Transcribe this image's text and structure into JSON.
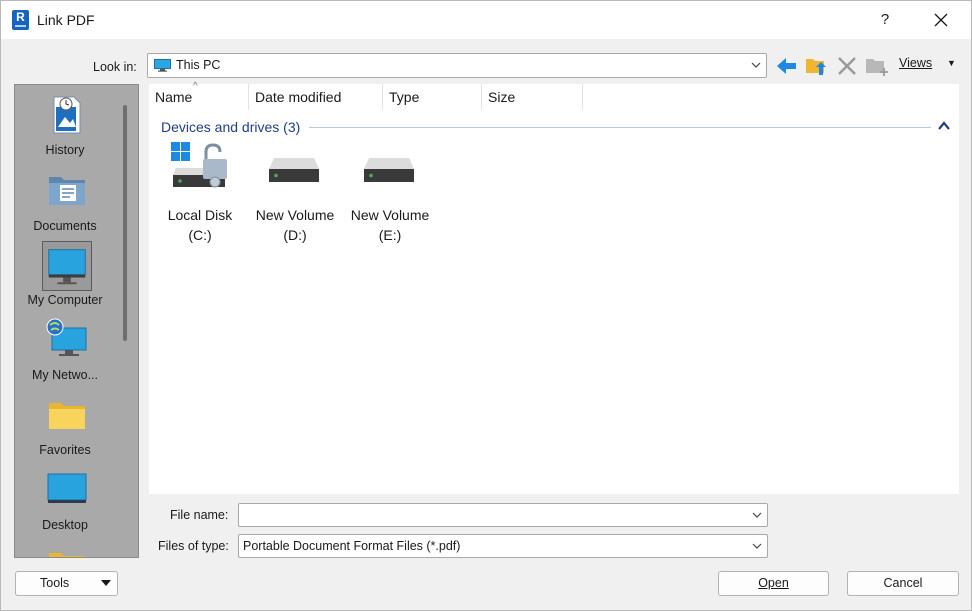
{
  "window": {
    "title": "Link PDF",
    "app_icon_letter": "R",
    "help_label": "?",
    "close_label": "✕"
  },
  "lookin": {
    "label": "Look in:",
    "value": "This PC"
  },
  "toolbar": {
    "back_icon": "back-arrow-icon",
    "up_folder_icon": "up-folder-icon",
    "delete_icon": "delete-icon",
    "new_folder_icon": "new-folder-icon",
    "views_label": "Views"
  },
  "places": [
    {
      "label": "History",
      "icon": "history-icon"
    },
    {
      "label": "Documents",
      "icon": "documents-icon"
    },
    {
      "label": "My Computer",
      "icon": "my-computer-icon",
      "selected": true
    },
    {
      "label": "My Netwo...",
      "icon": "network-icon"
    },
    {
      "label": "Favorites",
      "icon": "favorites-folder-icon"
    },
    {
      "label": "Desktop",
      "icon": "desktop-icon"
    }
  ],
  "columns": [
    {
      "label": "Name"
    },
    {
      "label": "Date modified"
    },
    {
      "label": "Type"
    },
    {
      "label": "Size"
    }
  ],
  "group": {
    "label": "Devices and drives (3)"
  },
  "drives": [
    {
      "line1": "Local Disk",
      "line2": "(C:)",
      "icon": "system-drive-icon"
    },
    {
      "line1": "New Volume",
      "line2": "(D:)",
      "icon": "drive-icon"
    },
    {
      "line1": "New Volume",
      "line2": "(E:)",
      "icon": "drive-icon"
    }
  ],
  "file_name": {
    "label": "File name:",
    "value": ""
  },
  "file_type": {
    "label": "Files of type:",
    "value": "Portable Document Format Files (*.pdf)"
  },
  "buttons": {
    "tools": "Tools",
    "open": "Open",
    "cancel": "Cancel"
  },
  "colors": {
    "places_bg": "#a9a9a9",
    "group_header": "#1e3f86",
    "accent_blue": "#1e88e5"
  }
}
